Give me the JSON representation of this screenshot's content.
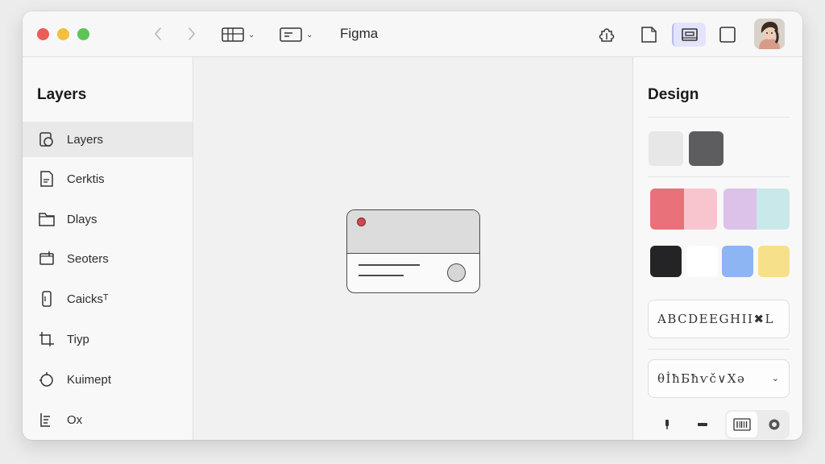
{
  "window": {
    "title": "Figma"
  },
  "colors": {
    "traffic_red": "#ee5c59",
    "traffic_yellow": "#f2bf3e",
    "traffic_green": "#5ec355",
    "selection": "#e3e4fb"
  },
  "toolbar": {
    "back_icon": "chevron-left-icon",
    "forward_icon": "chevron-right-icon",
    "frame_tool_icon": "frame-grid-icon",
    "text_tool_icon": "text-box-icon",
    "right_icons": [
      "plugin-icon",
      "page-icon",
      "layout-icon",
      "square-icon",
      "avatar"
    ]
  },
  "sidebar": {
    "title": "Layers",
    "items": [
      {
        "label": "Layers",
        "icon": "layers-icon",
        "selected": true
      },
      {
        "label": "Cerktis",
        "icon": "document-icon",
        "selected": false
      },
      {
        "label": "Dlays",
        "icon": "folder-icon",
        "selected": false
      },
      {
        "label": "Seoters",
        "icon": "frame-icon",
        "selected": false
      },
      {
        "label": "Caicksᵀ",
        "icon": "component-icon",
        "selected": false
      },
      {
        "label": "Tiyp",
        "icon": "crop-icon",
        "selected": false
      },
      {
        "label": "Kuimept",
        "icon": "shape-icon",
        "selected": false
      },
      {
        "label": "Ox",
        "icon": "list-icon",
        "selected": false
      }
    ]
  },
  "design": {
    "title": "Design",
    "swatches_row1": [
      "#e7e7e7",
      "#5d5d5f"
    ],
    "swatches_row2": [
      "#e8717a",
      "#f8c5cf",
      "#dcc1e8",
      "#c9e8ea"
    ],
    "swatches_row3": [
      "#242426",
      "#ffffff",
      "#8db4f3",
      "#f6e08a"
    ],
    "font_sample": "ABCDEEGHIІ✖L",
    "font_style_sample": "θİħБħѵč∨Χə",
    "font_dropdown_icon": "chevron-down-icon",
    "tools": [
      "pen-icon",
      "minus-icon",
      "barcode-icon",
      "circle-icon"
    ]
  }
}
